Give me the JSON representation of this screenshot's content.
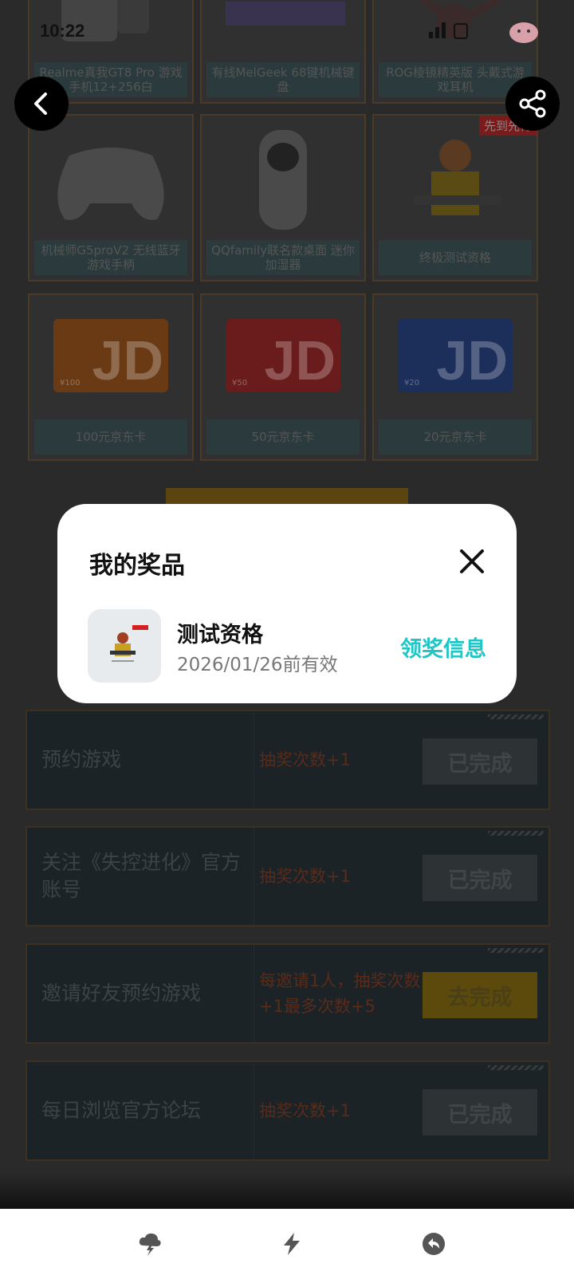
{
  "status_bar": {
    "time": "10:22"
  },
  "prizes": [
    {
      "label": "Realme真我GT8 Pro 游戏手机12+256白"
    },
    {
      "label": "有线MelGeek 68键机械键盘"
    },
    {
      "label": "ROG棱镜精英版 头戴式游戏耳机"
    },
    {
      "label": "机械师G5proV2 无线蓝牙游戏手柄"
    },
    {
      "label": "QQfamily联名款桌面 迷你加湿器"
    },
    {
      "label": "终极测试资格",
      "badge": "先到先得"
    },
    {
      "label": "100元京东卡",
      "card_value": "¥100",
      "card_color": "#e86a12"
    },
    {
      "label": "50元京东卡",
      "card_value": "¥50",
      "card_color": "#d42020"
    },
    {
      "label": "20元京东卡",
      "card_value": "¥20",
      "card_color": "#1a4fc8"
    }
  ],
  "tasks": [
    {
      "name": "预约游戏",
      "reward": "抽奖次数+1",
      "button": "已完成",
      "state": "done"
    },
    {
      "name": "关注《失控进化》官方账号",
      "reward": "抽奖次数+1",
      "button": "已完成",
      "state": "done"
    },
    {
      "name": "邀请好友预约游戏",
      "reward": "每邀请1人，抽奖次数+1最多次数+5",
      "button": "去完成",
      "state": "todo"
    },
    {
      "name": "每日浏览官方论坛",
      "reward": "抽奖次数+1",
      "button": "已完成",
      "state": "done"
    }
  ],
  "dialog": {
    "title": "我的奖品",
    "prize_name": "测试资格",
    "valid_until": "2026/01/26前有效",
    "claim_label": "领奖信息",
    "accent_color": "#1ec6c6"
  },
  "bottom_nav": [
    {
      "icon": "weather-bolt-icon"
    },
    {
      "icon": "lightning-icon"
    },
    {
      "icon": "back-arrow-icon"
    }
  ]
}
